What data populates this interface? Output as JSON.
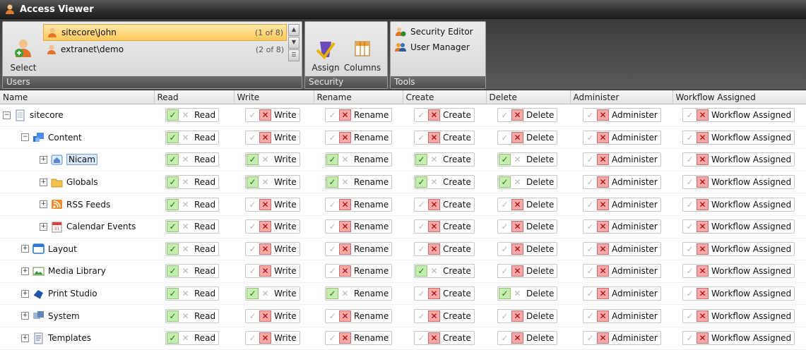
{
  "window": {
    "title": "Access Viewer"
  },
  "ribbon": {
    "users_group": {
      "caption": "Users",
      "select_label": "Select",
      "users": [
        {
          "name": "sitecore\\John",
          "count": "(1 of 8)"
        },
        {
          "name": "extranet\\demo",
          "count": "(2 of 8)"
        }
      ]
    },
    "security_group": {
      "caption": "Security",
      "assign_label": "Assign",
      "columns_label": "Columns"
    },
    "tools_group": {
      "caption": "Tools",
      "security_editor_label": "Security Editor",
      "user_manager_label": "User Manager"
    }
  },
  "grid": {
    "columns": [
      "Name",
      "Read",
      "Write",
      "Rename",
      "Create",
      "Delete",
      "Administer",
      "Workflow Assigned"
    ],
    "perm_labels": [
      "Read",
      "Write",
      "Rename",
      "Create",
      "Delete",
      "Administer",
      "Workflow Assigned"
    ],
    "rows": [
      {
        "name": "sitecore",
        "icon": "page-icon",
        "level": 0,
        "perms": [
          1,
          0,
          0,
          0,
          0,
          0,
          0
        ]
      },
      {
        "name": "Content",
        "icon": "content-icon",
        "level": 1,
        "perms": [
          1,
          0,
          0,
          0,
          0,
          0,
          0
        ]
      },
      {
        "name": "Nicam",
        "icon": "home-icon",
        "level": 2,
        "selected": true,
        "perms": [
          1,
          1,
          1,
          1,
          1,
          0,
          0
        ]
      },
      {
        "name": "Globals",
        "icon": "folder-icon",
        "level": 2,
        "perms": [
          1,
          1,
          1,
          1,
          1,
          0,
          0
        ]
      },
      {
        "name": "RSS Feeds",
        "icon": "rss-icon",
        "level": 2,
        "perms": [
          1,
          0,
          0,
          0,
          0,
          0,
          0
        ]
      },
      {
        "name": "Calendar Events",
        "icon": "calendar-icon",
        "level": 2,
        "perms": [
          1,
          0,
          0,
          0,
          0,
          0,
          0
        ]
      },
      {
        "name": "Layout",
        "icon": "layout-icon",
        "level": 1,
        "perms": [
          1,
          0,
          0,
          0,
          0,
          0,
          0
        ]
      },
      {
        "name": "Media Library",
        "icon": "image-icon",
        "level": 1,
        "perms": [
          1,
          0,
          0,
          1,
          0,
          0,
          0
        ]
      },
      {
        "name": "Print Studio",
        "icon": "print-studio-icon",
        "level": 1,
        "perms": [
          1,
          1,
          1,
          0,
          1,
          0,
          0
        ]
      },
      {
        "name": "System",
        "icon": "system-icon",
        "level": 1,
        "perms": [
          1,
          0,
          0,
          0,
          0,
          0,
          0
        ]
      },
      {
        "name": "Templates",
        "icon": "templates-icon",
        "level": 1,
        "perms": [
          1,
          0,
          0,
          0,
          0,
          0,
          0
        ]
      }
    ]
  }
}
